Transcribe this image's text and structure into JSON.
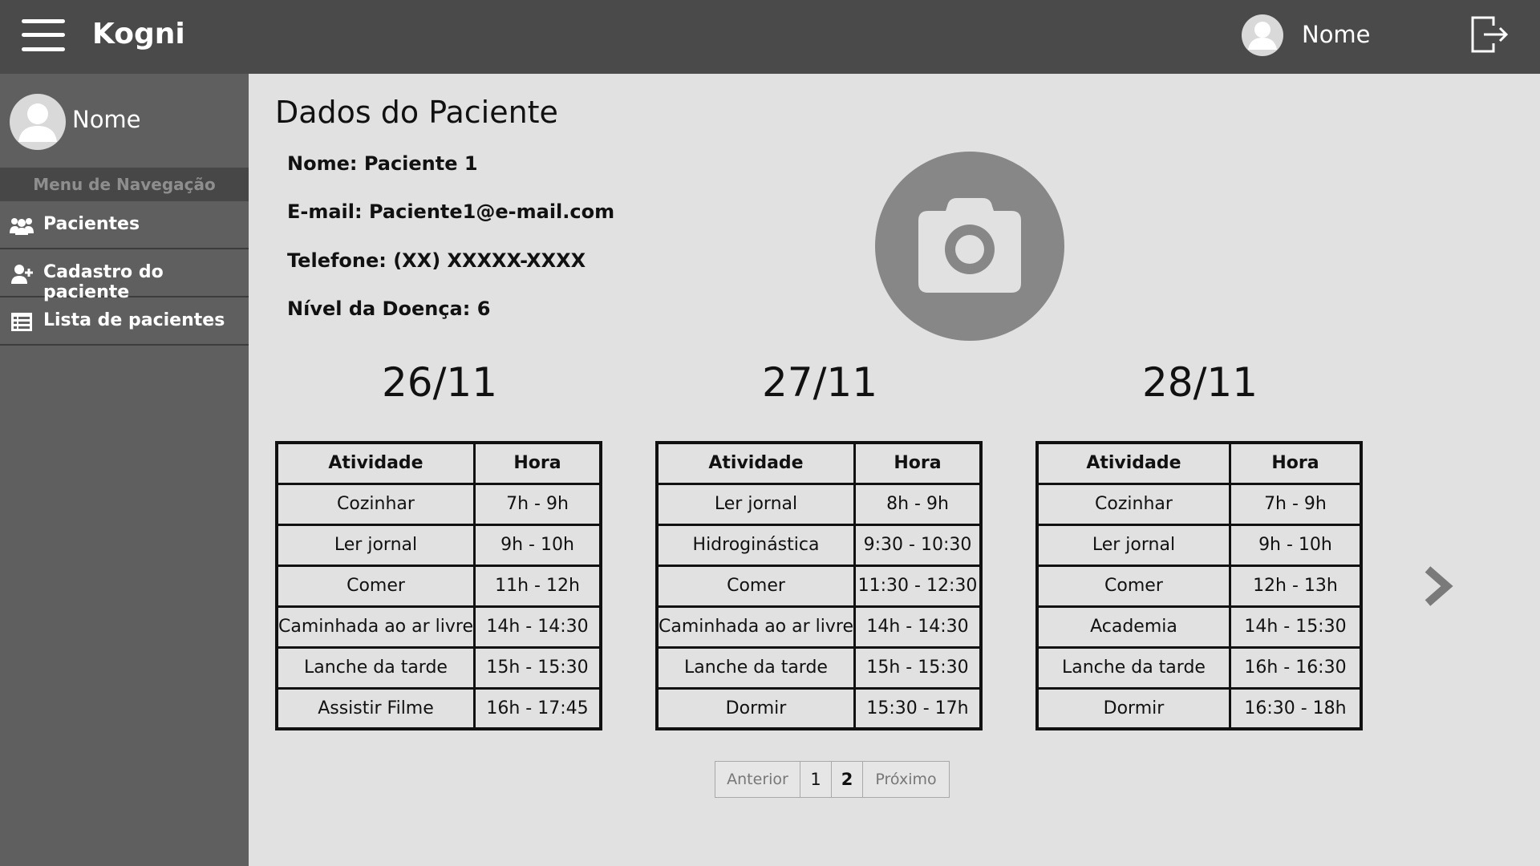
{
  "header": {
    "brand": "Kogni",
    "user_name": "Nome"
  },
  "sidebar": {
    "user_name": "Nome",
    "menu_title": "Menu de Navegação",
    "items": [
      {
        "label": "Pacientes",
        "icon": "users-icon"
      },
      {
        "label": "Cadastro do paciente",
        "icon": "user-plus-icon"
      },
      {
        "label": "Lista de pacientes",
        "icon": "list-icon"
      }
    ]
  },
  "main": {
    "title": "Dados do Paciente",
    "info": {
      "name": "Nome: Paciente 1",
      "email": "E-mail: Paciente1@e-mail.com",
      "phone": "Telefone: (XX) XXXXX-XXXX",
      "level": "Nível da Doença: 6"
    },
    "schedule_headers": {
      "activity": "Atividade",
      "time": "Hora"
    },
    "days": [
      {
        "date": "26/11",
        "rows": [
          [
            "Cozinhar",
            "7h - 9h"
          ],
          [
            "Ler jornal",
            "9h - 10h"
          ],
          [
            "Comer",
            "11h - 12h"
          ],
          [
            "Caminhada ao ar livre",
            "14h - 14:30"
          ],
          [
            "Lanche da tarde",
            "15h - 15:30"
          ],
          [
            "Assistir Filme",
            "16h - 17:45"
          ]
        ]
      },
      {
        "date": "27/11",
        "rows": [
          [
            "Ler jornal",
            "8h - 9h"
          ],
          [
            "Hidroginástica",
            "9:30 - 10:30"
          ],
          [
            "Comer",
            "11:30 - 12:30"
          ],
          [
            "Caminhada ao ar livre",
            "14h - 14:30"
          ],
          [
            "Lanche da tarde",
            "15h - 15:30"
          ],
          [
            "Dormir",
            "15:30 - 17h"
          ]
        ]
      },
      {
        "date": "28/11",
        "rows": [
          [
            "Cozinhar",
            "7h - 9h"
          ],
          [
            "Ler jornal",
            "9h - 10h"
          ],
          [
            "Comer",
            "12h - 13h"
          ],
          [
            "Academia",
            "14h - 15:30"
          ],
          [
            "Lanche da tarde",
            "16h - 16:30"
          ],
          [
            "Dormir",
            "16:30 - 18h"
          ]
        ]
      }
    ],
    "pagination": {
      "prev": "Anterior",
      "pages": [
        "1",
        "2"
      ],
      "current": "2",
      "next": "Próximo"
    }
  },
  "colors": {
    "header_bg": "#4a4a4a",
    "sidebar_bg": "#5f5f5f",
    "menu_title_bg": "#474747",
    "content_bg": "#e1e1e1",
    "photo_bg": "#878787"
  }
}
